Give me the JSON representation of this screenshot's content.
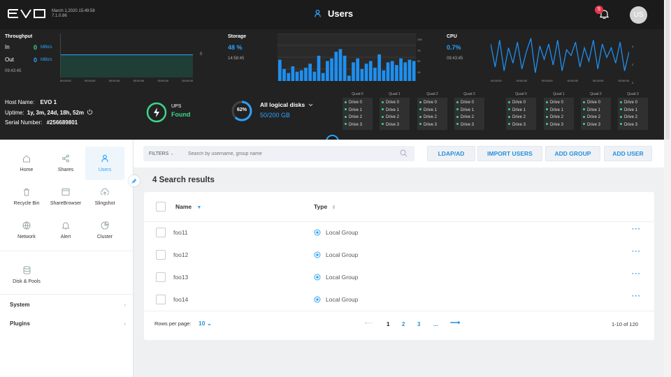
{
  "header": {
    "logo": "EVO",
    "datetime": "March 1,2020 15:49:58",
    "version": "7.1.0.86",
    "title": "Users",
    "notifications": "5",
    "avatar": "US"
  },
  "throughput": {
    "label": "Throughput",
    "in_label": "In",
    "in_value": "0",
    "in_unit": "MBit/s",
    "out_label": "Out",
    "out_value": "0",
    "out_unit": "MBit/s",
    "time": "09:43:45",
    "ymax": "0"
  },
  "storage": {
    "label": "Storage",
    "value": "48 %",
    "time": "14:58:45",
    "bars": [
      32,
      18,
      12,
      22,
      14,
      16,
      20,
      26,
      14,
      38,
      12,
      30,
      34,
      44,
      48,
      38,
      8,
      28,
      34,
      18,
      26,
      30,
      20,
      40,
      16,
      28,
      30,
      24,
      34,
      28,
      32,
      30
    ],
    "axis": [
      "100",
      "75",
      "50",
      "25"
    ]
  },
  "cpu": {
    "label": "CPU",
    "value": "0.7%",
    "time": "09:43:45",
    "line": [
      80,
      20,
      90,
      10,
      70,
      30,
      85,
      15,
      60,
      95,
      5,
      75,
      40,
      80,
      25,
      90,
      10,
      65,
      50,
      85,
      20,
      70,
      35,
      90,
      15,
      80,
      45,
      70,
      30,
      85,
      10,
      60
    ],
    "axis": [
      "4",
      "2",
      "0"
    ]
  },
  "host": {
    "name_label": "Host Name:",
    "name": "EVO 1",
    "uptime_label": "Uptime:",
    "uptime": "1y, 3m, 24d, 18h, 52m",
    "serial_label": "Serial Number:",
    "serial": "#256689801"
  },
  "ups": {
    "label": "UPS",
    "status": "Found"
  },
  "disks": {
    "percent": "62%",
    "percent_value": 62,
    "label": "All logical disks",
    "usage": "50/200 GB"
  },
  "quads": [
    "Quad 0",
    "Quad 1",
    "Quad 2",
    "Quad 3",
    "Quad 0",
    "Quad 1",
    "Quad 2",
    "Quad 3"
  ],
  "drives": [
    "Drive 0",
    "Drive 1",
    "Drive 2",
    "Drive 3"
  ],
  "nav": [
    {
      "label": "Home",
      "icon": "home-icon"
    },
    {
      "label": "Shares",
      "icon": "share-icon"
    },
    {
      "label": "Users",
      "icon": "user-icon"
    },
    {
      "label": "Recycle Bin",
      "icon": "trash-icon"
    },
    {
      "label": "ShareBrowser",
      "icon": "browser-icon"
    },
    {
      "label": "Slingshot",
      "icon": "upload-icon"
    },
    {
      "label": "Network",
      "icon": "network-icon"
    },
    {
      "label": "Alert",
      "icon": "bell-icon"
    },
    {
      "label": "Cluster",
      "icon": "pie-icon"
    }
  ],
  "disk_pools": "Disk & Pools",
  "system": "System",
  "plugins": "Plugins",
  "toolbar": {
    "filters": "FILTERS",
    "search_placeholder": "Search by username, group name",
    "ldap": "LDAP/AD",
    "import": "IMPORT USERS",
    "add_group": "ADD GROUP",
    "add_user": "ADD USER"
  },
  "results_title": "4 Search results",
  "table": {
    "col_name": "Name",
    "col_type": "Type",
    "rows": [
      {
        "name": "foo11",
        "type": "Local Group"
      },
      {
        "name": "foo12",
        "type": "Local Group"
      },
      {
        "name": "foo13",
        "type": "Local Group"
      },
      {
        "name": "foo14",
        "type": "Local Group"
      }
    ]
  },
  "pagination": {
    "rows_label": "Rows per page:",
    "rows_value": "10",
    "pages": [
      "1",
      "2",
      "3",
      "..."
    ],
    "range": "1-10 of 120"
  },
  "colors": {
    "accent": "#2aa3ff",
    "green": "#3ed48a",
    "dark": "#222222"
  }
}
